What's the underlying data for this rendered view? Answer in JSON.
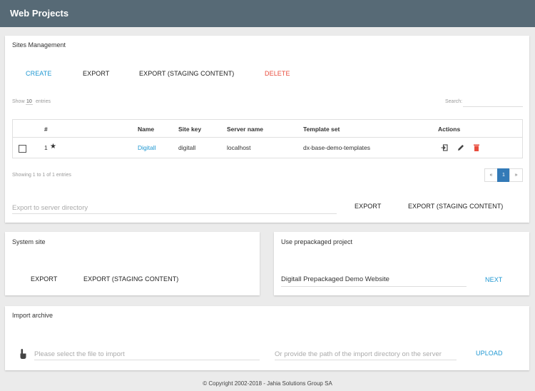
{
  "header": {
    "title": "Web Projects"
  },
  "sites": {
    "title": "Sites Management",
    "actions": {
      "create": "CREATE",
      "export": "EXPORT",
      "export_staging": "EXPORT (STAGING CONTENT)",
      "delete": "DELETE"
    },
    "show": {
      "prefix": "Show",
      "value": "10",
      "suffix": "entries"
    },
    "search_label": "Search:",
    "columns": {
      "num": "#",
      "name": "Name",
      "key": "Site key",
      "server": "Server name",
      "template": "Template set",
      "actions": "Actions"
    },
    "row": {
      "num": "1",
      "name": "Digitall",
      "key": "digitall",
      "server": "localhost",
      "template": "dx-base-demo-templates"
    },
    "showing": "Showing 1 to 1 of 1 entries",
    "pager": {
      "prev": "«",
      "page": "1",
      "next": "»"
    },
    "export_dir_placeholder": "Export to server directory",
    "export": "EXPORT",
    "export_staging": "EXPORT (STAGING CONTENT)"
  },
  "system": {
    "title": "System site",
    "export": "EXPORT",
    "export_staging": "EXPORT (STAGING CONTENT)"
  },
  "prepackaged": {
    "title": "Use prepackaged project",
    "value": "Digitall Prepackaged Demo Website",
    "next": "NEXT"
  },
  "import": {
    "title": "Import archive",
    "file_placeholder": "Please select the file to import",
    "path_placeholder": "Or provide the path of the import directory on the server",
    "upload": "UPLOAD"
  },
  "footer": {
    "copyright": "© Copyright 2002-2018 - Jahia Solutions Group SA"
  },
  "colors": {
    "header_bg": "#576a76",
    "accent": "#1e97d2",
    "danger": "#e84c3d",
    "page_active": "#337ab7"
  }
}
